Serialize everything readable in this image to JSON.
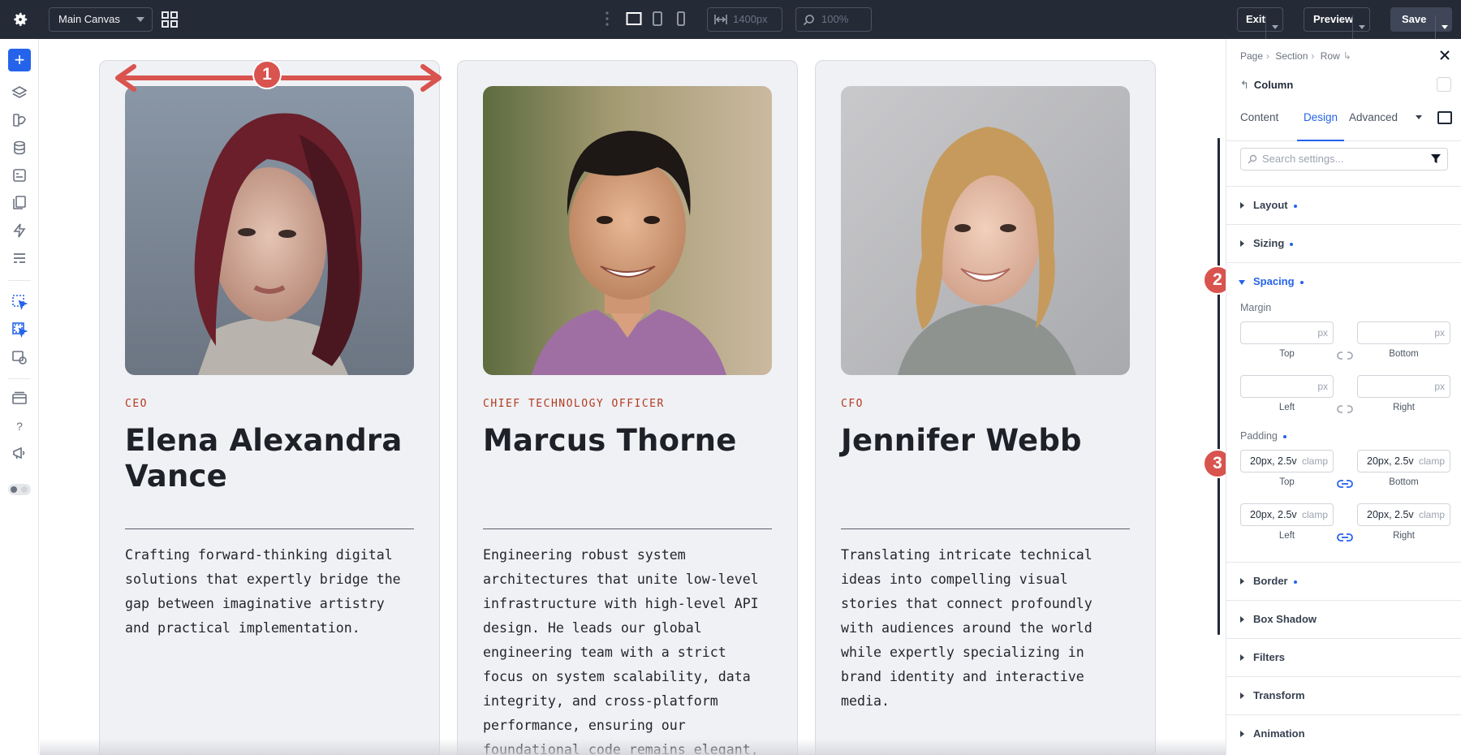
{
  "topbar": {
    "canvas_select": "Main Canvas",
    "width_value": "1400px",
    "zoom_value": "100%",
    "exit_label": "Exit",
    "preview_label": "Preview",
    "save_label": "Save"
  },
  "annotations": [
    "1",
    "2",
    "3"
  ],
  "cards": [
    {
      "role": "CEO",
      "name": "Elena Alexandra Vance",
      "bio": "Crafting forward-thinking digital solutions that expertly bridge the gap between imaginative artistry and practical implementation."
    },
    {
      "role": "CHIEF TECHNOLOGY OFFICER",
      "name": "Marcus Thorne",
      "bio": "Engineering robust system architectures that unite low-level infrastructure with high-level API design. He leads our global engineering team with a strict focus on system scalability, data integrity, and cross-platform performance, ensuring our foundational code remains elegant,"
    },
    {
      "role": "CFO",
      "name": "Jennifer Webb",
      "bio": "Translating intricate technical ideas into compelling visual stories that connect profoundly with audiences around the world while expertly specializing in brand identity and interactive media."
    }
  ],
  "panel": {
    "breadcrumb": [
      "Page",
      "Section",
      "Row"
    ],
    "element_title": "Column",
    "tabs": [
      "Content",
      "Design",
      "Advanced"
    ],
    "active_tab": "Design",
    "search_placeholder": "Search settings...",
    "sections": {
      "layout": "Layout",
      "sizing": "Sizing",
      "spacing": "Spacing",
      "border": "Border",
      "box_shadow": "Box Shadow",
      "filters": "Filters",
      "transform": "Transform",
      "animation": "Animation"
    },
    "margin": {
      "label": "Margin",
      "unit": "px",
      "captions": {
        "top": "Top",
        "bottom": "Bottom",
        "left": "Left",
        "right": "Right"
      },
      "values": {
        "top": "",
        "bottom": "",
        "left": "",
        "right": ""
      }
    },
    "padding": {
      "label": "Padding",
      "unit": "clamp",
      "captions": {
        "top": "Top",
        "bottom": "Bottom",
        "left": "Left",
        "right": "Right"
      },
      "values": {
        "top": "20px, 2.5v",
        "bottom": "20px, 2.5v",
        "left": "20px, 2.5v",
        "right": "20px, 2.5v"
      }
    }
  },
  "colors": {
    "topbar_bg": "#252a37",
    "accent_blue": "#2563eb",
    "role_text": "#b23a1e",
    "annotation_red": "#d9534f",
    "card_bg": "#f0f1f5"
  }
}
